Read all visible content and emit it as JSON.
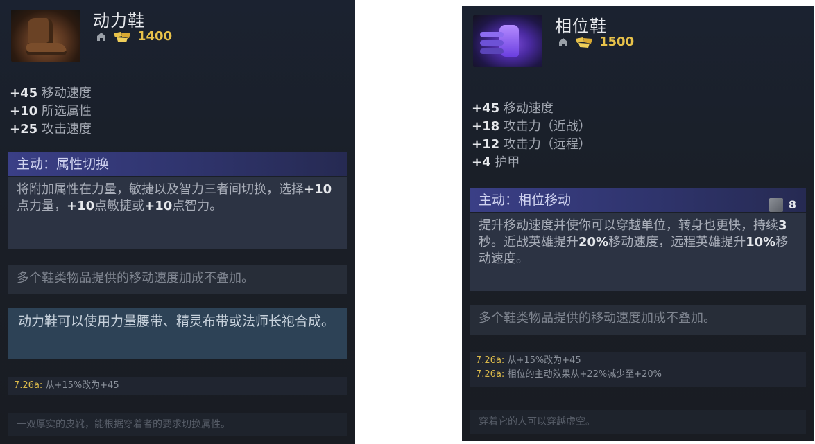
{
  "left": {
    "name": "动力鞋",
    "cost": "1400",
    "icon": "power-treads-icon",
    "stats": [
      {
        "value": "+45",
        "label": "移动速度"
      },
      {
        "value": "+10",
        "label": "所选属性"
      },
      {
        "value": "+25",
        "label": "攻击速度"
      }
    ],
    "active_title": "主动：属性切换",
    "active_desc": [
      {
        "t": "将附加属性在力量，敏捷以及智力三者间切换，选择"
      },
      {
        "b": "+10"
      },
      {
        "t": "点力量，"
      },
      {
        "b": "+10"
      },
      {
        "t": "点敏捷或"
      },
      {
        "b": "+10"
      },
      {
        "t": "点智力。"
      }
    ],
    "note": "多个鞋类物品提供的移动速度加成不叠加。",
    "recipe": "动力鞋可以使用力量腰带、精灵布带或法师长袍合成。",
    "patch_notes": [
      {
        "version": "7.26a:",
        "text": "从+15%改为+45"
      }
    ],
    "lore": "一双厚实的皮靴，能根据穿着者的要求切换属性。"
  },
  "right": {
    "name": "相位鞋",
    "cost": "1500",
    "icon": "phase-boots-icon",
    "stats": [
      {
        "value": "+45",
        "label": "移动速度"
      },
      {
        "value": "+18",
        "label": "攻击力（近战）"
      },
      {
        "value": "+12",
        "label": "攻击力（远程）"
      },
      {
        "value": "+4",
        "label": "护甲"
      }
    ],
    "active_title": "主动：相位移动",
    "cooldown": "8",
    "active_desc": [
      {
        "t": "提升移动速度并使你可以穿越单位，转身也更快，持续"
      },
      {
        "b": "3"
      },
      {
        "t": "秒。近战英雄提升"
      },
      {
        "b": "20%"
      },
      {
        "t": "移动速度，远程英雄提升"
      },
      {
        "b": "10%"
      },
      {
        "t": "移动速度。"
      }
    ],
    "note": "多个鞋类物品提供的移动速度加成不叠加。",
    "patch_notes": [
      {
        "version": "7.26a:",
        "text": "从+15%改为+45"
      },
      {
        "version": "7.26a:",
        "text": "相位的主动效果从+22%减少至+20%"
      }
    ],
    "lore": "穿着它的人可以穿越虚空。"
  }
}
